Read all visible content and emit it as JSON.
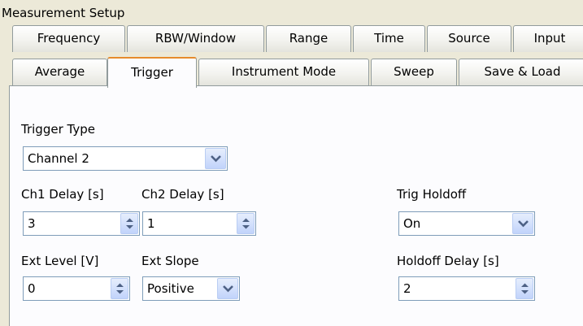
{
  "window": {
    "title": "Measurement Setup"
  },
  "tabs_row1": [
    {
      "label": "Frequency"
    },
    {
      "label": "RBW/Window"
    },
    {
      "label": "Range"
    },
    {
      "label": "Time"
    },
    {
      "label": "Source"
    },
    {
      "label": "Input"
    }
  ],
  "tabs_row2": [
    {
      "label": "Average"
    },
    {
      "label": "Trigger"
    },
    {
      "label": "Instrument Mode"
    },
    {
      "label": "Sweep"
    },
    {
      "label": "Save & Load"
    }
  ],
  "active_tab": "Trigger",
  "trigger": {
    "type_label": "Trigger Type",
    "type_value": "Channel 2",
    "ch1_delay_label": "Ch1 Delay [s]",
    "ch1_delay_value": "3",
    "ch2_delay_label": "Ch2 Delay [s]",
    "ch2_delay_value": "1",
    "ext_level_label": "Ext Level [V]",
    "ext_level_value": "0",
    "ext_slope_label": "Ext Slope",
    "ext_slope_value": "Positive",
    "holdoff_label": "Trig Holdoff",
    "holdoff_value": "On",
    "holdoff_delay_label": "Holdoff Delay [s]",
    "holdoff_delay_value": "2"
  },
  "icons": {
    "dropdown": "chevron-down-icon",
    "spinner": "spin-arrows-icon"
  }
}
